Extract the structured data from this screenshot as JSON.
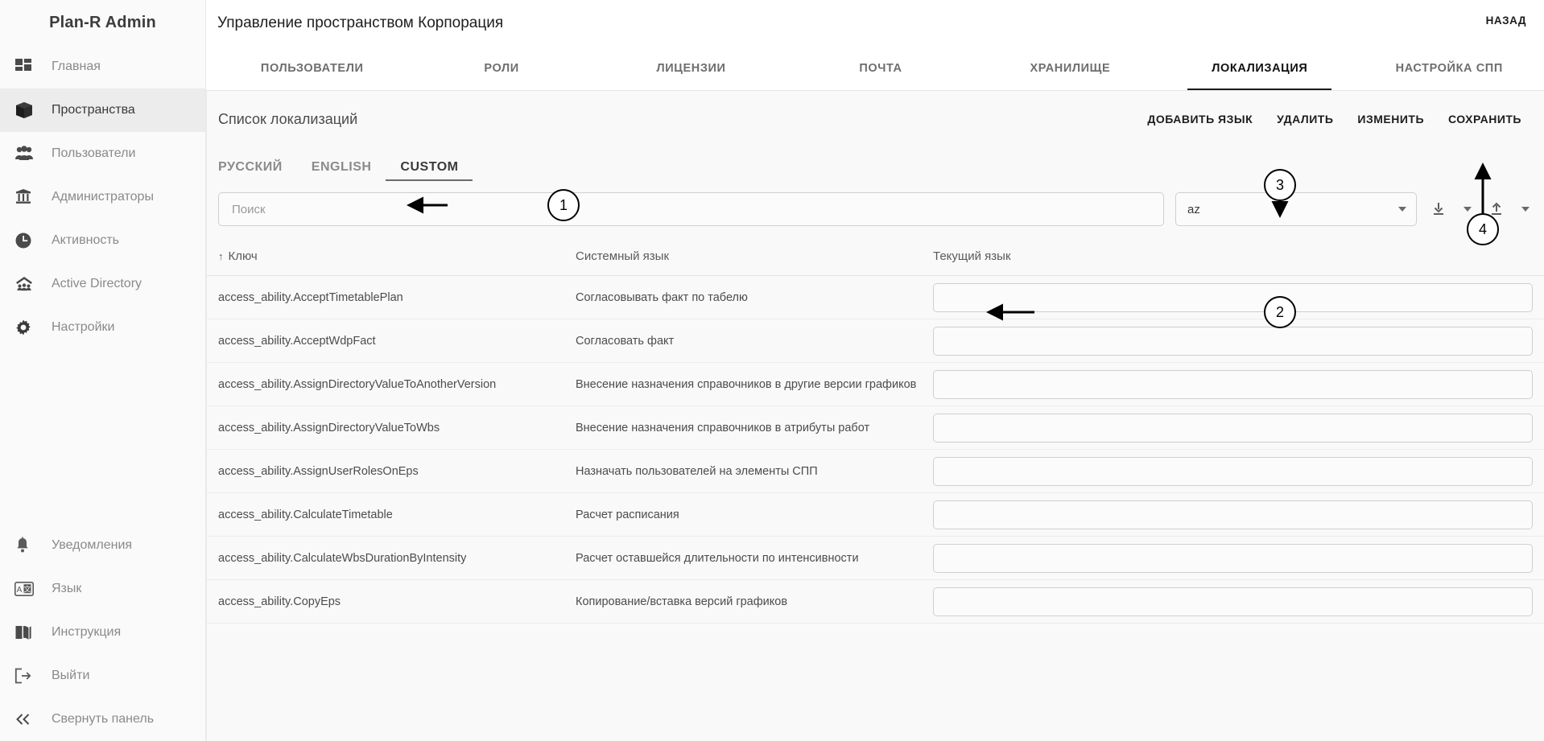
{
  "app": {
    "brand": "Plan-R Admin"
  },
  "sidebar": {
    "items_top": [
      {
        "label": "Главная",
        "icon": "dashboard-icon",
        "active": false
      },
      {
        "label": "Пространства",
        "icon": "cube-icon",
        "active": true
      },
      {
        "label": "Пользователи",
        "icon": "users-icon",
        "active": false
      },
      {
        "label": "Администраторы",
        "icon": "admin-shield-icon",
        "active": false
      },
      {
        "label": "Активность",
        "icon": "clock-icon",
        "active": false
      },
      {
        "label": "Active Directory",
        "icon": "active-directory-icon",
        "active": false
      },
      {
        "label": "Настройки",
        "icon": "gear-icon",
        "active": false
      }
    ],
    "items_bottom": [
      {
        "label": "Уведомления",
        "icon": "bell-icon"
      },
      {
        "label": "Язык",
        "icon": "translate-icon"
      },
      {
        "label": "Инструкция",
        "icon": "book-icon"
      },
      {
        "label": "Выйти",
        "icon": "logout-icon"
      },
      {
        "label": "Свернуть панель",
        "icon": "collapse-icon"
      }
    ]
  },
  "header": {
    "title": "Управление пространством Корпорация",
    "back_label": "НАЗАД"
  },
  "tabs": [
    {
      "label": "ПОЛЬЗОВАТЕЛИ",
      "active": false
    },
    {
      "label": "РОЛИ",
      "active": false
    },
    {
      "label": "ЛИЦЕНЗИИ",
      "active": false
    },
    {
      "label": "ПОЧТА",
      "active": false
    },
    {
      "label": "ХРАНИЛИЩЕ",
      "active": false
    },
    {
      "label": "ЛОКАЛИЗАЦИЯ",
      "active": true
    },
    {
      "label": "НАСТРОЙКА СПП",
      "active": false
    }
  ],
  "toolbar": {
    "title": "Список локализаций",
    "actions": [
      {
        "label": "ДОБАВИТЬ ЯЗЫК"
      },
      {
        "label": "УДАЛИТЬ"
      },
      {
        "label": "ИЗМЕНИТЬ"
      },
      {
        "label": "СОХРАНИТЬ"
      }
    ]
  },
  "lang_tabs": [
    {
      "label": "РУССКИЙ",
      "active": false
    },
    {
      "label": "ENGLISH",
      "active": false
    },
    {
      "label": "CUSTOM",
      "active": true
    }
  ],
  "filters": {
    "search_placeholder": "Поиск",
    "search_value": "",
    "language_select_value": "az",
    "download_icon": "download-icon",
    "upload_icon": "upload-icon"
  },
  "table": {
    "columns": [
      {
        "label": "Ключ",
        "sort": "↑"
      },
      {
        "label": "Системный язык"
      },
      {
        "label": "Текущий язык"
      }
    ],
    "rows": [
      {
        "key": "access_ability.AcceptTimetablePlan",
        "system": "Согласовывать факт по табелю",
        "current": ""
      },
      {
        "key": "access_ability.AcceptWdpFact",
        "system": "Согласовать факт",
        "current": ""
      },
      {
        "key": "access_ability.AssignDirectoryValueToAnotherVersion",
        "system": "Внесение назначения справочников в другие версии графиков",
        "current": ""
      },
      {
        "key": "access_ability.AssignDirectoryValueToWbs",
        "system": "Внесение назначения справочников в атрибуты работ",
        "current": ""
      },
      {
        "key": "access_ability.AssignUserRolesOnEps",
        "system": "Назначать пользователей на элементы СПП",
        "current": ""
      },
      {
        "key": "access_ability.CalculateTimetable",
        "system": "Расчет расписания",
        "current": ""
      },
      {
        "key": "access_ability.CalculateWbsDurationByIntensity",
        "system": "Расчет оставшейся длительности по интенсивности",
        "current": ""
      },
      {
        "key": "access_ability.CopyEps",
        "system": "Копирование/вставка версий графиков",
        "current": ""
      }
    ]
  },
  "annotations": [
    {
      "number": "1"
    },
    {
      "number": "2"
    },
    {
      "number": "3"
    },
    {
      "number": "4"
    }
  ]
}
